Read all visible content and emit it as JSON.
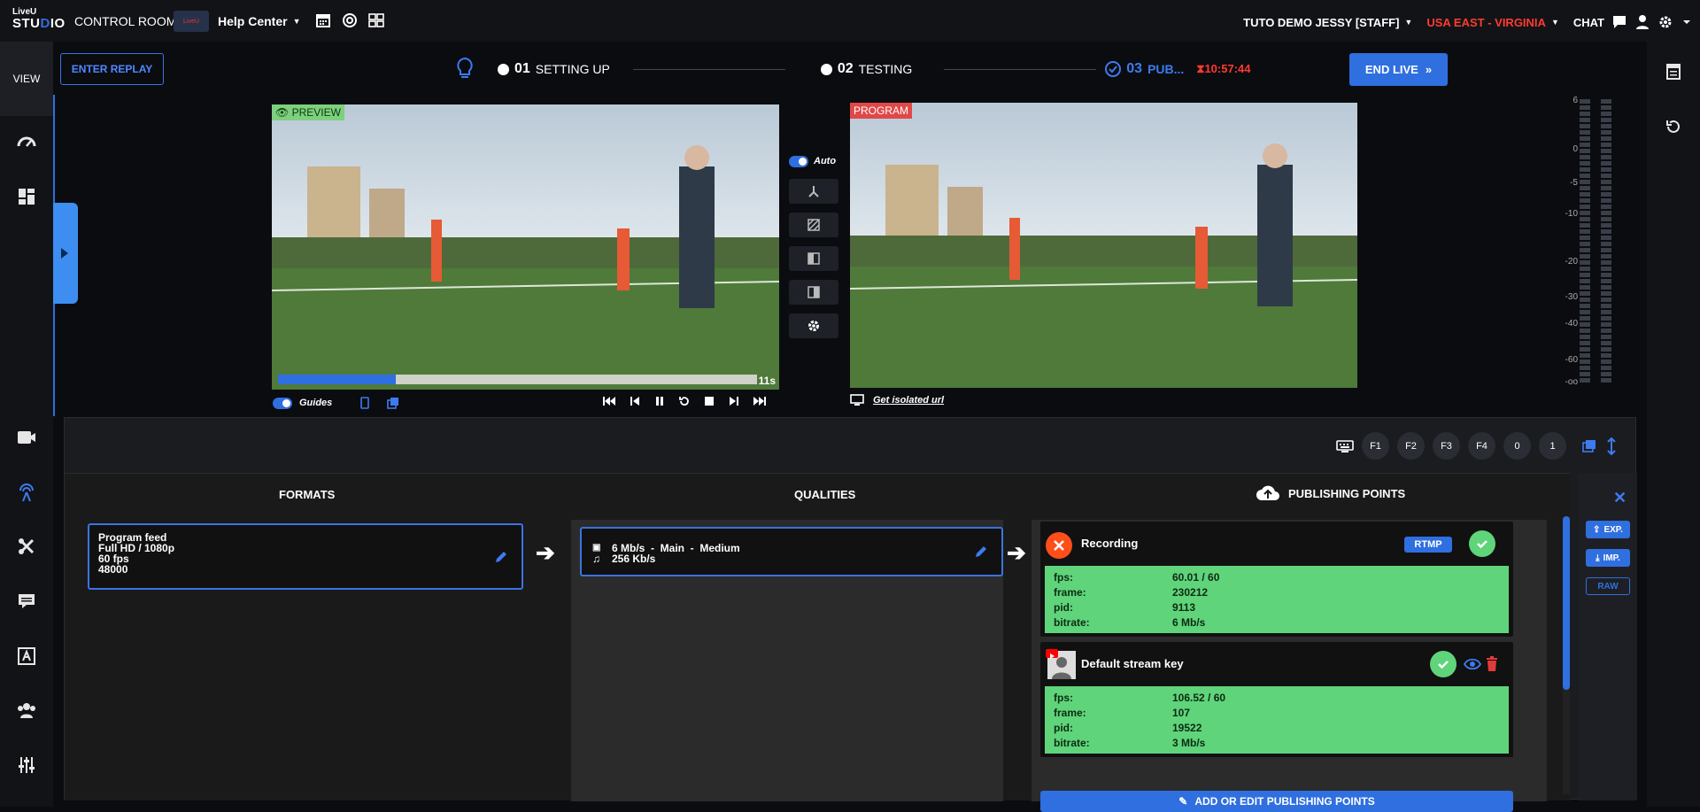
{
  "topbar": {
    "logo_line1": "LiveU",
    "logo_line2a": "STU",
    "logo_line2b": "D",
    "logo_line2c": "IO",
    "control_rooms": "CONTROL ROOMS",
    "help_logo": "LiveU",
    "help_center": "Help Center",
    "user": "TUTO DEMO JESSY [STAFF]",
    "region": "USA EAST - VIRGINIA",
    "chat": "CHAT"
  },
  "sidebar": {
    "view_label": "VIEW",
    "icons": [
      "dashboard-icon",
      "layout-icon",
      "camera-icon",
      "broadcast-icon",
      "tools-icon",
      "comments-icon",
      "text-icon",
      "guests-icon",
      "sliders-icon"
    ]
  },
  "header": {
    "replay": "ENTER REPLAY",
    "steps": [
      {
        "num": "01",
        "label": "SETTING UP"
      },
      {
        "num": "02",
        "label": "TESTING"
      },
      {
        "num": "03",
        "label": "PUB..."
      }
    ],
    "timer": "10:57:44",
    "end_live": "END LIVE"
  },
  "preview": {
    "tag": "PREVIEW",
    "time": "11s",
    "progress": 0.246
  },
  "program": {
    "tag": "PROGRAM"
  },
  "controls": {
    "auto": "Auto",
    "guides": "Guides",
    "isolated_url": "Get isolated url"
  },
  "vu": {
    "labels": [
      "6",
      "0",
      "-5",
      "-10",
      "-20",
      "-30",
      "-40",
      "-60",
      "-oo"
    ]
  },
  "keys": [
    "F1",
    "F2",
    "F3",
    "F4",
    "0",
    "1"
  ],
  "publishing": {
    "formats_head": "FORMATS",
    "qualities_head": "QUALITIES",
    "pp_head": "PUBLISHING POINTS",
    "format": {
      "line1": "Program feed",
      "line2": "Full HD / 1080p",
      "line3": "60 fps",
      "line4": "48000"
    },
    "quality": {
      "video": "6 Mb/s  -  Main  -  Medium",
      "audio": "256 Kb/s"
    },
    "points": [
      {
        "name": "Recording",
        "badge": "RTMP",
        "stats": [
          {
            "k": "fps:",
            "v": "60.01 / 60"
          },
          {
            "k": "frame:",
            "v": "230212"
          },
          {
            "k": "pid:",
            "v": "9113"
          },
          {
            "k": "bitrate:",
            "v": "6 Mb/s"
          }
        ]
      },
      {
        "name": "Default stream key",
        "stats": [
          {
            "k": "fps:",
            "v": "106.52 / 60"
          },
          {
            "k": "frame:",
            "v": "107"
          },
          {
            "k": "pid:",
            "v": "19522"
          },
          {
            "k": "bitrate:",
            "v": "3 Mb/s"
          }
        ]
      }
    ],
    "add_button": "ADD OR EDIT PUBLISHING POINTS",
    "exp": "EXP.",
    "imp": "IMP.",
    "raw": "RAW",
    "close": "✕"
  }
}
